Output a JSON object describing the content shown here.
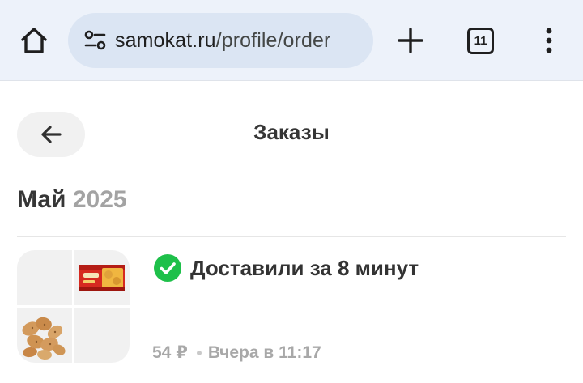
{
  "browser": {
    "url_host": "samokat.ru",
    "url_path": "/profile/order",
    "tab_count": "11",
    "icons": [
      "home-icon",
      "site-settings-icon",
      "new-tab-icon",
      "tab-switcher-icon",
      "more-menu-icon"
    ]
  },
  "page": {
    "title": "Заказы",
    "back_icon": "arrow-left-icon"
  },
  "month_group": {
    "month": "Май",
    "year": "2025"
  },
  "orders": [
    {
      "status": "Доставили за 8 минут",
      "status_icon": "check-circle-icon",
      "status_color": "#1ec04a",
      "price": "54 ₽",
      "time": "Вчера в 11:17",
      "thumbnails": [
        "cookie-pack-image",
        "cookies-image"
      ]
    }
  ],
  "colors": {
    "chrome_bg": "#edf2fa",
    "urlbar_bg": "#dbe5f3",
    "button_bg": "#f1f1f1",
    "success": "#1ec04a",
    "muted": "#a3a3a3"
  }
}
